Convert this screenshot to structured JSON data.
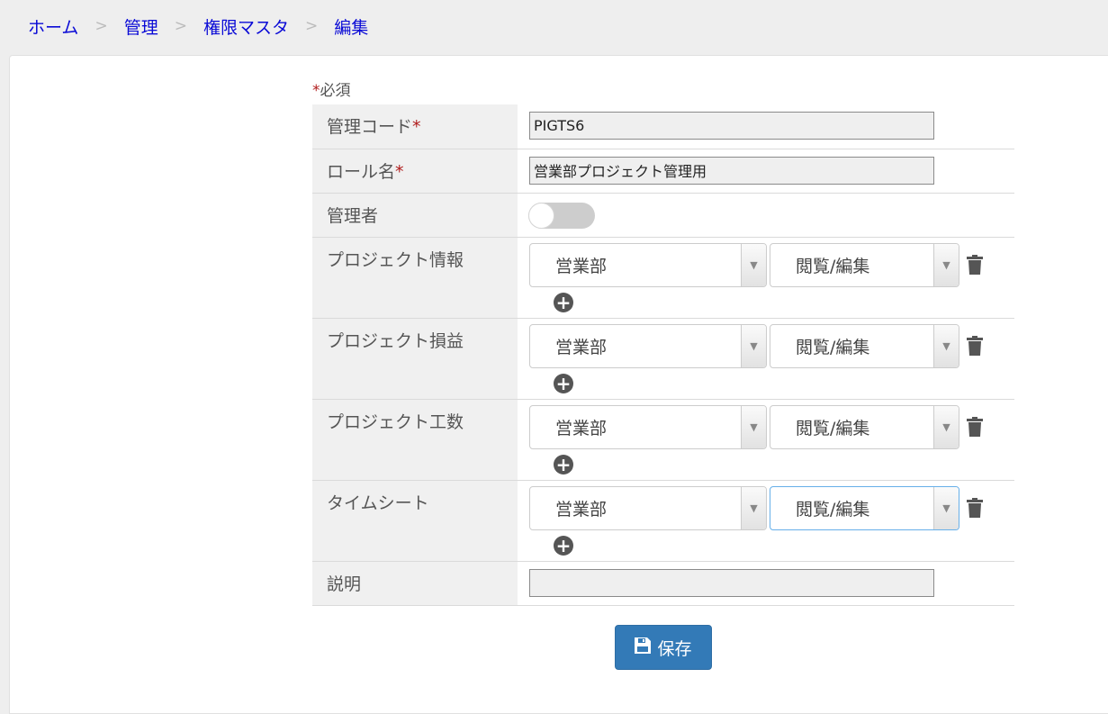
{
  "breadcrumb": {
    "items": [
      "ホーム",
      "管理",
      "権限マスタ",
      "編集"
    ],
    "separator": ">"
  },
  "form": {
    "required_note": "必須",
    "required_mark": "*",
    "fields": {
      "code": {
        "label": "管理コード",
        "value": "PIGTS6"
      },
      "role_name": {
        "label": "ロール名",
        "value": "営業部プロジェクト管理用"
      },
      "admin": {
        "label": "管理者",
        "checked": false
      },
      "project_info": {
        "label": "プロジェクト情報",
        "dept": "営業部",
        "perm": "閲覧/編集"
      },
      "project_pl": {
        "label": "プロジェクト損益",
        "dept": "営業部",
        "perm": "閲覧/編集"
      },
      "project_hours": {
        "label": "プロジェクト工数",
        "dept": "営業部",
        "perm": "閲覧/編集"
      },
      "timesheet": {
        "label": "タイムシート",
        "dept": "営業部",
        "perm": "閲覧/編集"
      },
      "description": {
        "label": "説明",
        "value": ""
      }
    }
  },
  "save_button": {
    "label": "保存",
    "icon": "floppy-disk-icon"
  },
  "colors": {
    "link": "#0a0ad6",
    "primary": "#337ab7",
    "required": "#b01c1c",
    "label_bg": "#f0f0f0"
  }
}
